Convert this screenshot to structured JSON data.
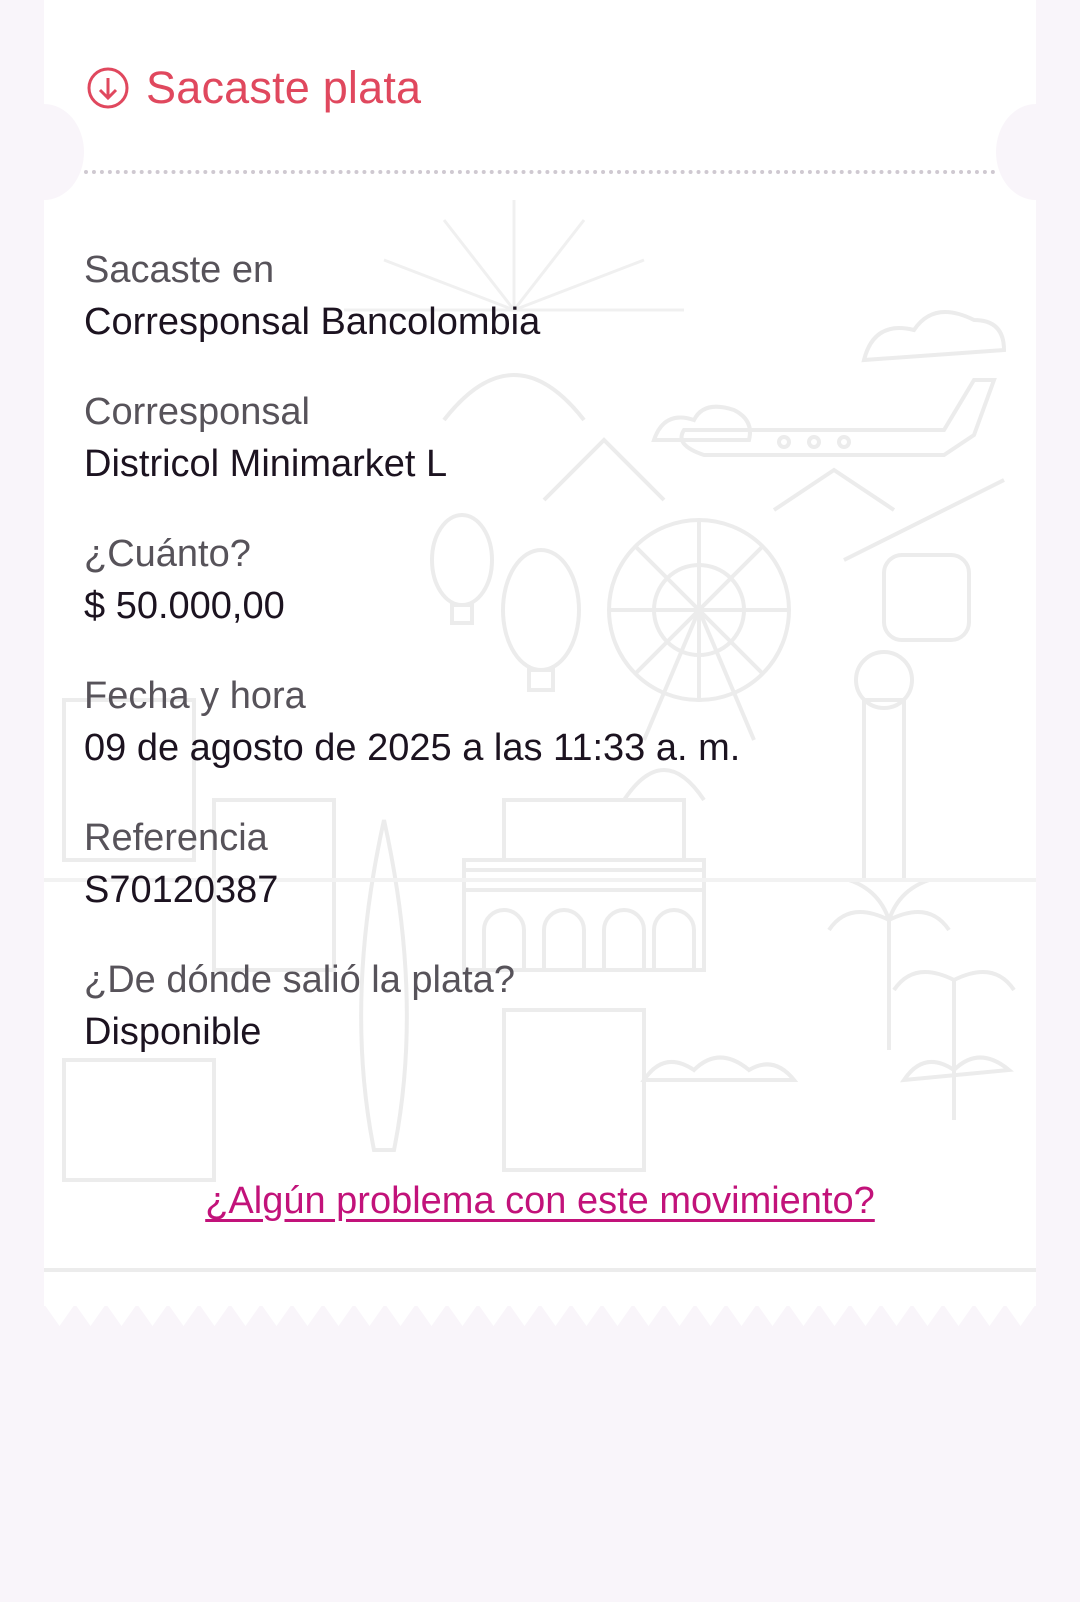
{
  "header": {
    "icon": "arrow-down-circle-icon",
    "title": "Sacaste plata",
    "accent_color": "#e0485e"
  },
  "fields": [
    {
      "label": "Sacaste en",
      "value": "Corresponsal Bancolombia"
    },
    {
      "label": "Corresponsal",
      "value": "Districol Minimarket L"
    },
    {
      "label": "¿Cuánto?",
      "value": "$ 50.000,00"
    },
    {
      "label": "Fecha y hora",
      "value": "09 de agosto de 2025 a las 11:33 a. m."
    },
    {
      "label": "Referencia",
      "value": "S70120387"
    },
    {
      "label": "¿De dónde salió la plata?",
      "value": "Disponible"
    }
  ],
  "problem_link": {
    "label": "¿Algún problema con este movimiento?",
    "color": "#c2127a"
  }
}
